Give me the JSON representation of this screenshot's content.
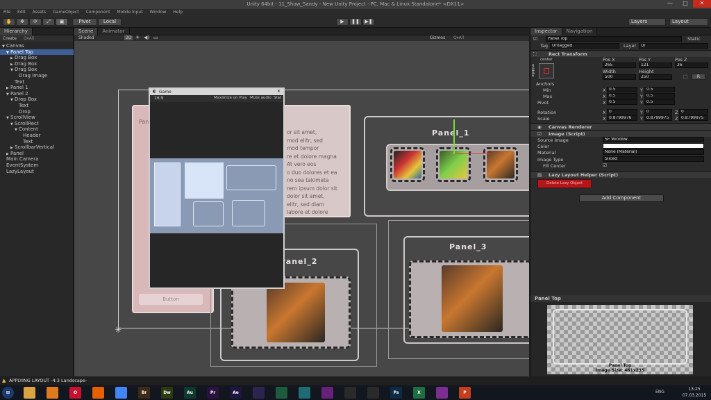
{
  "window": {
    "title": "Unity 64bit - 11_Show_Sandy - New Unity Project - PC, Mac & Linux Standalone* <DX11>",
    "menu": [
      "File",
      "Edit",
      "Assets",
      "GameObject",
      "Component",
      "Mobile Input",
      "Window",
      "Help"
    ],
    "minimize": "—",
    "maximize": "□",
    "close": "✕"
  },
  "toolbar": {
    "pivot": "Pivot",
    "local": "Local",
    "layers": "Layers",
    "layout": "Layout"
  },
  "hierarchy": {
    "tab": "Hierarchy",
    "create": "Create",
    "search_placeholder": "Q▾All",
    "items": [
      {
        "label": "Canvas",
        "depth": 0,
        "arrow": "▼"
      },
      {
        "label": "Panel Top",
        "depth": 1,
        "arrow": "▼",
        "selected": true
      },
      {
        "label": "Drag Box",
        "depth": 2,
        "arrow": "▶"
      },
      {
        "label": "Drag Box",
        "depth": 2,
        "arrow": "▶"
      },
      {
        "label": "Drag Box",
        "depth": 2,
        "arrow": "▼"
      },
      {
        "label": "Drag Image",
        "depth": 3,
        "arrow": ""
      },
      {
        "label": "Text",
        "depth": 2,
        "arrow": ""
      },
      {
        "label": "Panel 1",
        "depth": 1,
        "arrow": "▶"
      },
      {
        "label": "Panel 2",
        "depth": 1,
        "arrow": "▼"
      },
      {
        "label": "Drop Box",
        "depth": 2,
        "arrow": "▼"
      },
      {
        "label": "Text",
        "depth": 3,
        "arrow": ""
      },
      {
        "label": "Drop",
        "depth": 3,
        "arrow": ""
      },
      {
        "label": "ScrollView",
        "depth": 1,
        "arrow": "▼"
      },
      {
        "label": "ScrollRect",
        "depth": 2,
        "arrow": "▼"
      },
      {
        "label": "Content",
        "depth": 3,
        "arrow": "▼"
      },
      {
        "label": "Header",
        "depth": 4,
        "arrow": ""
      },
      {
        "label": "Text",
        "depth": 4,
        "arrow": ""
      },
      {
        "label": "ScrollbarVertical",
        "depth": 2,
        "arrow": "▶"
      },
      {
        "label": "Panel",
        "depth": 1,
        "arrow": "▶"
      },
      {
        "label": "Main Camera",
        "depth": 0,
        "arrow": ""
      },
      {
        "label": "EventSystem",
        "depth": 0,
        "arrow": ""
      },
      {
        "label": "LazyLayout",
        "depth": 0,
        "arrow": ""
      }
    ]
  },
  "scene": {
    "tab_scene": "Scene",
    "tab_animator": "Animator",
    "shaded": "Shaded",
    "mode_2d": "2D",
    "gizmos": "Gizmos",
    "search": "Q▾All",
    "panel_1": "Panel_1",
    "panel_2": "Panel_2",
    "panel_3": "Panel_3",
    "panel_label_left": "Pan",
    "button_label": "Button",
    "lorem_lines": [
      "or sit amet,",
      "mod elitr, sed",
      "mod tempor",
      "re et dolore magna",
      "At vero eos",
      "o duo dolores et ea",
      "no sea takimata",
      "rem ipsum dolor sit",
      "dolor sit amet,",
      "elitr, sed diam",
      "labore et dolore"
    ]
  },
  "game": {
    "title": "Game",
    "aspect": "16:9",
    "maximize": "Maximize on Play",
    "mute": "Mute audio",
    "stats": "Stat"
  },
  "inspector": {
    "tab_inspector": "Inspector",
    "tab_navigation": "Navigation",
    "object_name": "Panel Top",
    "static_label": "Static",
    "tag_label": "Tag",
    "tag_value": "Untagged",
    "layer_label": "Layer",
    "layer_value": "UI",
    "rect_transform": "Rect Transform",
    "anchor_preset": "center",
    "anchor_side": "middle",
    "pos_x_label": "Pos X",
    "pos_y_label": "Pos Y",
    "pos_z_label": "Pos Z",
    "pos_x": "265",
    "pos_y": "121",
    "pos_z": "26",
    "width_label": "Width",
    "height_label": "Height",
    "width": "500",
    "height": "250",
    "r_button": "R",
    "anchors": "Anchors",
    "min": "Min",
    "max": "Max",
    "pivot": "Pivot",
    "min_x": "0.5",
    "min_y": "0.5",
    "max_x": "0.5",
    "max_y": "0.5",
    "pivot_x": "0.5",
    "pivot_y": "0.5",
    "rotation": "Rotation",
    "rot_x": "0",
    "rot_y": "0",
    "rot_z": "0",
    "scale": "Scale",
    "scale_x": "0.8799976",
    "scale_y": "0.8799975",
    "scale_z": "0.8799975",
    "canvas_renderer": "Canvas Renderer",
    "image_script": "Image (Script)",
    "source_image_label": "Source Image",
    "source_image": "SF Window",
    "color_label": "Color",
    "material_label": "Material",
    "material": "None (Material)",
    "image_type_label": "Image Type",
    "image_type": "Sliced",
    "fill_center": "Fill Center",
    "lazy_helper": "Lazy Layout Helper (Script)",
    "delete_button": "Delete Lazy Object",
    "add_component": "Add Component",
    "x_axis": "X",
    "y_axis": "Y",
    "z_axis": "Z"
  },
  "preview": {
    "title": "Panel Top",
    "caption_name": "Panel Top",
    "caption_size": "Image Size: 461x235"
  },
  "status": {
    "message": "APPLYING LAYOUT -4:3 Landscape-"
  },
  "taskbar": {
    "items": [
      {
        "icon": "folder-icon",
        "label": "",
        "color": "#d9a441"
      },
      {
        "icon": "media-player-icon",
        "label": "",
        "color": "#e07a1f"
      },
      {
        "icon": "opera-icon",
        "label": "O",
        "color": "#c4122f"
      },
      {
        "icon": "firefox-icon",
        "label": "",
        "color": "#e66000"
      },
      {
        "icon": "chrome-icon",
        "label": "",
        "color": "#4285f4"
      },
      {
        "icon": "bridge-icon",
        "label": "Br",
        "color": "#3d2a16"
      },
      {
        "icon": "dreamweaver-icon",
        "label": "Dw",
        "color": "#2c3a10"
      },
      {
        "icon": "audition-icon",
        "label": "Au",
        "color": "#0e3b2f"
      },
      {
        "icon": "premiere-icon",
        "label": "Pr",
        "color": "#2a1140"
      },
      {
        "icon": "after-effects-icon",
        "label": "Ae",
        "color": "#1f1540"
      },
      {
        "icon": "media-encoder-icon",
        "label": "",
        "color": "#2b2550"
      },
      {
        "icon": "app-icon",
        "label": "",
        "color": "#1d5b3f"
      },
      {
        "icon": "game-icon",
        "label": "",
        "color": "#1f6c76"
      },
      {
        "icon": "visual-studio-icon",
        "label": "",
        "color": "#68217a"
      },
      {
        "icon": "unity-icon",
        "label": "",
        "color": "#2a2a2a"
      },
      {
        "icon": "unity-icon-2",
        "label": "",
        "color": "#2a2a2a"
      },
      {
        "icon": "photoshop-icon",
        "label": "Ps",
        "color": "#0e2a44"
      },
      {
        "icon": "excel-icon",
        "label": "X",
        "color": "#1d6f42"
      },
      {
        "icon": "onenote-icon",
        "label": "",
        "color": "#7b2e8f"
      },
      {
        "icon": "powerpoint-icon",
        "label": "P",
        "color": "#c43e1c"
      }
    ],
    "tray_lang": "ENG",
    "clock": "13:25",
    "date": "07.03.2015"
  },
  "colors": {
    "selection": "#3e5f96",
    "delete_button": "#b3171b",
    "status_warning": "#e8c43a"
  }
}
